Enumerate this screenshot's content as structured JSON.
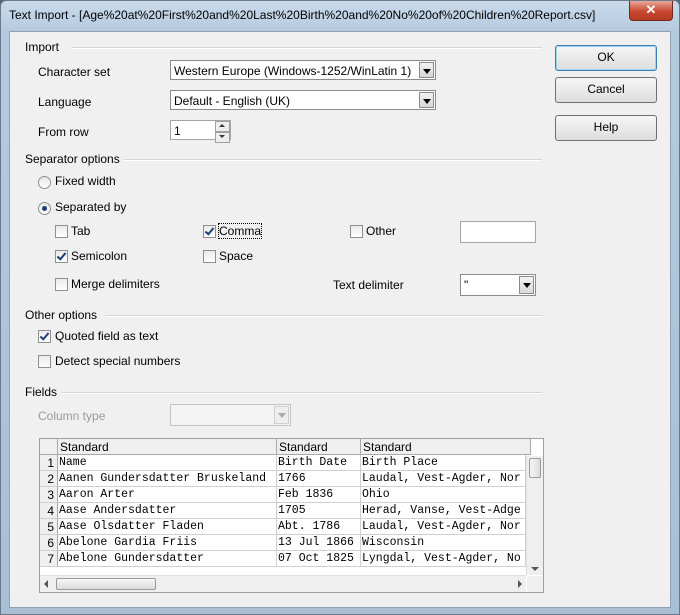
{
  "window": {
    "title": "Text Import - [Age%20at%20First%20and%20Last%20Birth%20and%20No%20of%20Children%20Report.csv]",
    "close_glyph": "✕"
  },
  "import_section": {
    "heading": "Import",
    "character_set_label": "Character set",
    "character_set_value": "Western Europe (Windows-1252/WinLatin 1)",
    "language_label": "Language",
    "language_value": "Default - English (UK)",
    "from_row_label": "From row",
    "from_row_value": "1"
  },
  "separator_options": {
    "heading": "Separator options",
    "fixed_width": {
      "label": "Fixed width",
      "selected": false
    },
    "separated_by": {
      "label": "Separated by",
      "selected": true
    },
    "tab": {
      "label": "Tab",
      "checked": false
    },
    "comma": {
      "label": "Comma",
      "checked": true
    },
    "other": {
      "label": "Other",
      "checked": false,
      "value": ""
    },
    "semicolon": {
      "label": "Semicolon",
      "checked": true
    },
    "space": {
      "label": "Space",
      "checked": false
    },
    "merge_delimiters": {
      "label": "Merge delimiters",
      "checked": false
    },
    "text_delimiter_label": "Text delimiter",
    "text_delimiter_value": "\""
  },
  "other_options": {
    "heading": "Other options",
    "quoted_field_as_text": {
      "label": "Quoted field as text",
      "checked": true
    },
    "detect_special_numbers": {
      "label": "Detect special numbers",
      "checked": false
    }
  },
  "fields": {
    "heading": "Fields",
    "column_type_label": "Column type",
    "column_type_value": "",
    "columns": [
      "Standard",
      "Standard",
      "Standard"
    ],
    "rows": [
      {
        "n": "1",
        "cells": [
          "Name",
          "Birth Date",
          "Birth Place"
        ]
      },
      {
        "n": "2",
        "cells": [
          "Aanen Gundersdatter Bruskeland",
          "1766",
          "Laudal, Vest-Agder, Nor"
        ]
      },
      {
        "n": "3",
        "cells": [
          "Aaron Arter",
          "Feb 1836",
          "Ohio"
        ]
      },
      {
        "n": "4",
        "cells": [
          "Aase Andersdatter",
          "1705",
          "Herad, Vanse, Vest-Adge"
        ]
      },
      {
        "n": "5",
        "cells": [
          "Aase Olsdatter Fladen",
          "Abt. 1786",
          "Laudal, Vest-Agder, Nor"
        ]
      },
      {
        "n": "6",
        "cells": [
          "Abelone Gardia Friis",
          "13 Jul 1866",
          "Wisconsin"
        ]
      },
      {
        "n": "7",
        "cells": [
          "Abelone Gundersdatter",
          "07 Oct 1825",
          "Lyngdal, Vest-Agder, No"
        ]
      }
    ]
  },
  "buttons": {
    "ok": "OK",
    "cancel": "Cancel",
    "help": "Help"
  }
}
